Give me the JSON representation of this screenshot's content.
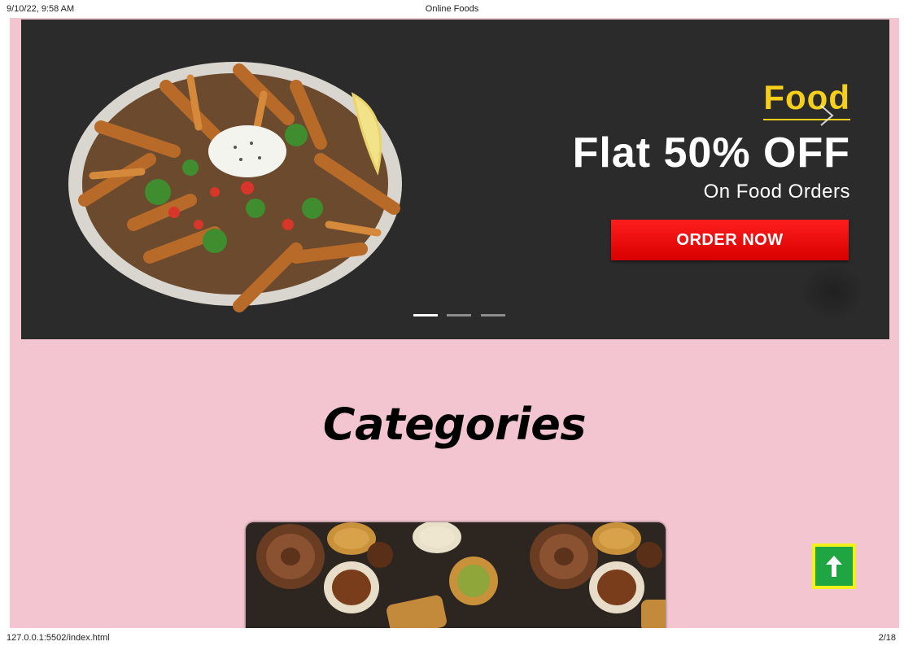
{
  "print": {
    "datetime": "9/10/22, 9:58 AM",
    "title": "Online Foods",
    "url": "127.0.0.1:5502/index.html",
    "page": "2/18"
  },
  "carousel": {
    "kicker": "Food",
    "headline": "Flat 50% OFF",
    "subline": "On Food Orders",
    "cta": "ORDER NOW",
    "slides": 3,
    "active_slide": 1
  },
  "categories": {
    "title": "Categories"
  },
  "icons": {
    "next": "chevron-right-icon",
    "back_to_top": "arrow-up-icon"
  },
  "colors": {
    "page_bg": "#f2c5d0",
    "banner_bg": "#2b2b2b",
    "kicker": "#f5cf1a",
    "cta": "#ff1e1e",
    "back_to_top_bg": "#1fa542",
    "back_to_top_border": "#f2f21a"
  }
}
